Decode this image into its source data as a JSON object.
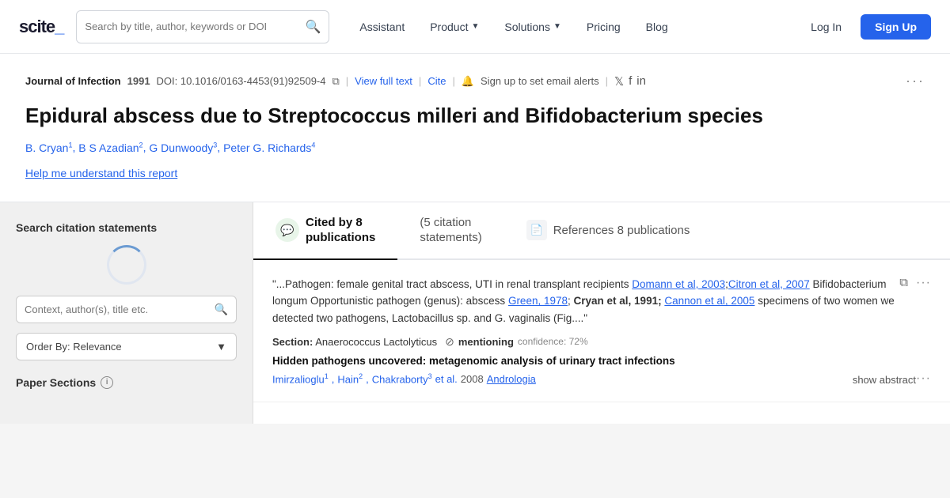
{
  "logo": {
    "text": "scite_",
    "underscore": "_"
  },
  "search": {
    "placeholder": "Search by title, author, keywords or DOI"
  },
  "nav": {
    "items": [
      {
        "label": "Assistant",
        "hasDropdown": false
      },
      {
        "label": "Product",
        "hasDropdown": true
      },
      {
        "label": "Solutions",
        "hasDropdown": true
      },
      {
        "label": "Pricing",
        "hasDropdown": false
      },
      {
        "label": "Blog",
        "hasDropdown": false
      }
    ],
    "login": "Log In",
    "signup": "Sign Up"
  },
  "article": {
    "journal": "Journal of Infection",
    "year": "1991",
    "doi": "DOI: 10.1016/0163-4453(91)92509-4",
    "view_full_text": "View full text",
    "cite": "Cite",
    "alert": "Sign up to set email alerts",
    "title": "Epidural abscess due to Streptococcus milleri and Bifidobacterium species",
    "authors": [
      {
        "name": "B. Cryan",
        "sup": "1"
      },
      {
        "name": "B S Azadian",
        "sup": "2"
      },
      {
        "name": "G Dunwoody",
        "sup": "3"
      },
      {
        "name": "Peter G. Richards",
        "sup": "4"
      }
    ],
    "help_link": "Help me understand this report"
  },
  "sidebar": {
    "title": "Search citation statements",
    "input_placeholder": "Context, author(s), title etc.",
    "order_by": "Order By: Relevance",
    "paper_sections_label": "Paper Sections"
  },
  "tabs": [
    {
      "id": "cited",
      "icon": "💬",
      "icon_bg": "#e8f5e9",
      "label": "Cited by 8",
      "sublabel": "publications",
      "active": true
    },
    {
      "id": "statements",
      "label": "(5 citation",
      "sublabel": "statements)",
      "active": false
    },
    {
      "id": "references",
      "icon": "📄",
      "label": "References 8 publications",
      "active": false
    }
  ],
  "citation": {
    "quote": "\"...Pathogen: female genital tract abscess, UTI in renal transplant recipients Domann et al, 2003;Citron et al, 2007 Bifidobacterium longum Opportunistic pathogen (genus): abscess Green, 1978;  Cryan et al, 1991; Cannon et al, 2005 specimens of two women we detected two pathogens, Lactobacillus sp. and G. vaginalis (Fig....\"",
    "section_label": "Section:",
    "section_value": "Anaerococcus Lactolyticus",
    "mentioning": "mentioning",
    "confidence_label": "confidence:",
    "confidence_value": "72%",
    "paper_title": "Hidden pathogens uncovered: metagenomic analysis of urinary tract infections",
    "paper_authors": [
      {
        "name": "Imirzalioglu",
        "sup": "1"
      },
      {
        "name": "Hain",
        "sup": "2"
      },
      {
        "name": "Chakraborty",
        "sup": "3"
      }
    ],
    "et_al": "et al.",
    "year": "2008",
    "journal": "Andrologia",
    "show_abstract": "show abstract"
  }
}
